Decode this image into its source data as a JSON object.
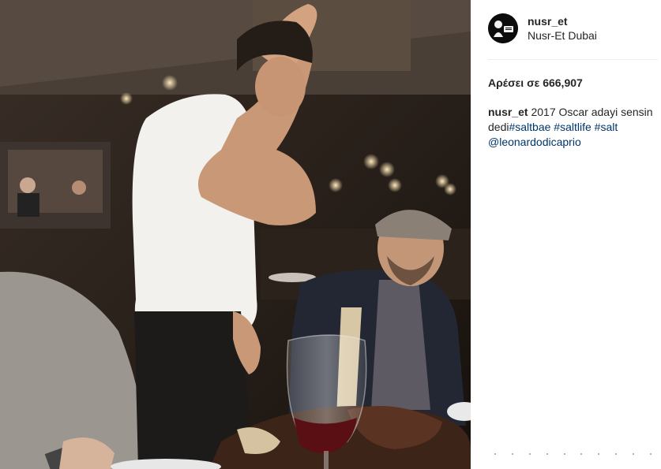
{
  "post": {
    "username": "nusr_et",
    "location": "Nusr-Et Dubai",
    "avatar_icon": "nusr-et-logo-icon",
    "photo_icon": "restaurant-photo-icon"
  },
  "likes": {
    "text": "Αρέσει σε 666,907"
  },
  "caption": {
    "username": "nusr_et",
    "text_1": "2017 Oscar adayi sensin",
    "text_2": "dedi",
    "tags": [
      "#saltbae",
      "#saltlife",
      "#salt",
      "@leonardodicaprio"
    ]
  },
  "colors": {
    "text": "#262626",
    "link": "#003569",
    "divider": "#efefef"
  }
}
